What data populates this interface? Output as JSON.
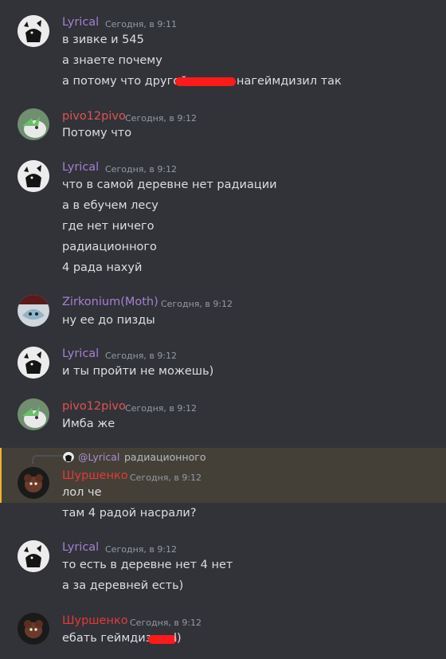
{
  "colors": {
    "lyrical": "#a77fd4",
    "pivo": "#e05353",
    "zirkonium": "#a77fd4",
    "shurshenko": "#e53935",
    "background": "#313338",
    "redaction": "#ff1a1a"
  },
  "messages": [
    {
      "author": "Lyrical",
      "time": "Сегодня, в 9:11",
      "lines": [
        "в зивке и 545",
        "а знаете почему",
        "а потому что другой ",
        "нагеймдизил так"
      ]
    },
    {
      "author": "pivo12pivo",
      "time": "Сегодня, в 9:12",
      "lines": [
        "Потому что"
      ]
    },
    {
      "author": "Lyrical",
      "time": "Сегодня, в 9:12",
      "lines": [
        "что в самой деревне нет радиации",
        "а в ебучем лесу",
        "где нет ничего",
        "радиационного",
        "4 рада нахуй"
      ]
    },
    {
      "author": "Zirkonium(Moth)",
      "time": "Сегодня, в 9:12",
      "lines": [
        "ну ее до пизды"
      ]
    },
    {
      "author": "Lyrical",
      "time": "Сегодня, в 9:12",
      "lines": [
        "и ты пройти не можешь)"
      ]
    },
    {
      "author": "pivo12pivo",
      "time": "Сегодня, в 9:12",
      "lines": [
        "Имба же"
      ]
    },
    {
      "author": "Шуршенко",
      "time": "Сегодня, в 9:12",
      "reply": {
        "mention": "@Lyrical",
        "text": "радиационного"
      },
      "lines": [
        "лол че",
        "там 4 радой насрали?"
      ]
    },
    {
      "author": "Lyrical",
      "time": "Сегодня, в 9:12",
      "lines": [
        "то есть в деревне нет 4 нет",
        "а за деревней есть)"
      ]
    },
    {
      "author": "Шуршенко",
      "time": "Сегодня, в 9:12",
      "lines": [
        "ебать геймдиз",
        "l)"
      ]
    }
  ],
  "icons": {
    "lyrical_avatar": "black-cat-avatar-icon",
    "pivo_avatar": "character-avatar-icon",
    "zirkonium_avatar": "stalker-avatar-icon",
    "shurshenko_avatar": "sheep-avatar-icon"
  }
}
